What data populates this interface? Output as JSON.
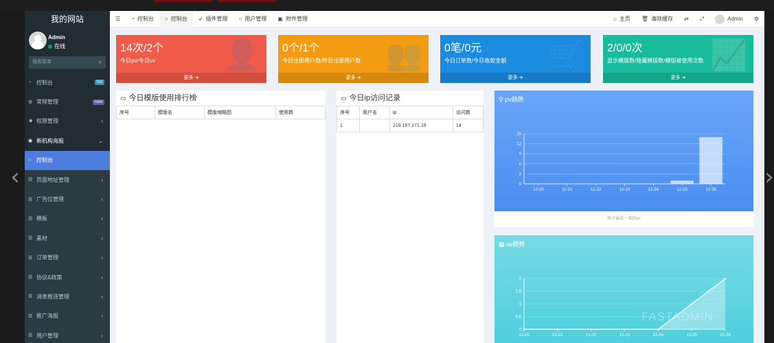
{
  "sidebar": {
    "logo": "我的网站",
    "user_name": "Admin",
    "user_status": "在线",
    "search_placeholder": "搜索菜单",
    "items": [
      {
        "label": "控制台",
        "badge": "hot",
        "badge_color": "#3c8dbc"
      },
      {
        "label": "常规管理",
        "badge": "new",
        "badge_color": "#605ca8"
      },
      {
        "label": "权限管理"
      },
      {
        "label": "新机构海报"
      },
      {
        "label": "控制台"
      },
      {
        "label": "页面地址管理"
      },
      {
        "label": "广告位管理"
      },
      {
        "label": "模板"
      },
      {
        "label": "素材"
      },
      {
        "label": "订单管理"
      },
      {
        "label": "协议&政策"
      },
      {
        "label": "消息推送管理"
      },
      {
        "label": "推广海报"
      },
      {
        "label": "用户管理"
      }
    ]
  },
  "topbar": {
    "tabs": [
      "控制台",
      "控制台",
      "插件管理",
      "用户管理",
      "附件管理"
    ],
    "home": "主页",
    "clear_cache": "清除缓存",
    "admin": "Admin"
  },
  "stats": [
    {
      "value": "14次/2个",
      "desc": "今日pv/今日uv",
      "more": "更多",
      "color": "#f05a48"
    },
    {
      "value": "0个/1个",
      "desc": "今日注册用户数/昨日注册用户数",
      "more": "更多",
      "color": "#f39c12"
    },
    {
      "value": "0笔/0元",
      "desc": "今日订单数/今日收款金额",
      "more": "更多",
      "color": "#1b8be0"
    },
    {
      "value": "2/0/0次",
      "desc": "显示模版数/隐藏模版数/模版被使用次数",
      "more": "更多",
      "color": "#18bc9c"
    }
  ],
  "template_rank": {
    "title": "今日模版使用排行榜",
    "columns": [
      "序号",
      "模版名",
      "模版缩略图",
      "使用数"
    ],
    "rows": []
  },
  "ip_log": {
    "title": "今日ip访问记录",
    "columns": [
      "序号",
      "用户名",
      "ip",
      "访问数"
    ],
    "rows": [
      [
        "1",
        "",
        "219.157.171.19",
        "14"
      ]
    ]
  },
  "pv_chart": {
    "title": "pv趋势",
    "footnote": "统计最近一周的pv",
    "chart_data": {
      "type": "bar",
      "categories": [
        "12-20",
        "12-21",
        "12-22",
        "12-23",
        "12-24",
        "12-25",
        "12-26"
      ],
      "values": [
        0,
        0,
        0,
        0,
        0,
        1,
        14
      ],
      "ylim": [
        0,
        15
      ],
      "yticks": [
        0,
        3,
        6,
        9,
        12,
        15
      ]
    }
  },
  "uv_chart": {
    "title": "uv趋势",
    "chart_data": {
      "type": "area",
      "categories": [
        "12-20",
        "12-21",
        "12-22",
        "12-23",
        "12-24",
        "12-25",
        "12-26"
      ],
      "values": [
        0,
        0,
        0,
        0,
        0,
        1,
        2
      ],
      "ylim": [
        0,
        2
      ],
      "yticks": [
        0,
        0.5,
        1,
        1.5,
        2
      ]
    }
  },
  "watermark": "FASTADMIN"
}
